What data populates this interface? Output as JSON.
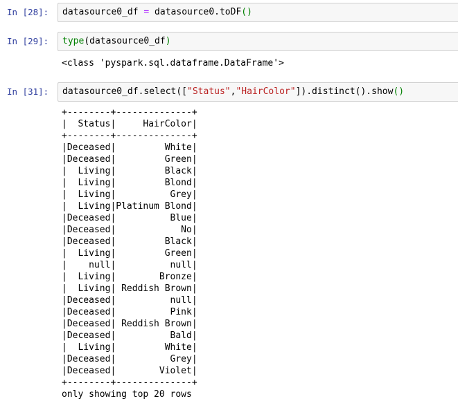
{
  "cells": [
    {
      "prompt": "In [28]:",
      "code": [
        {
          "text": "datasource0_df ",
          "cls": "tok-name"
        },
        {
          "text": "=",
          "cls": "tok-op"
        },
        {
          "text": " datasource0.toDF",
          "cls": "tok-name"
        },
        {
          "text": "()",
          "cls": "tok-kw"
        }
      ]
    },
    {
      "prompt": "In [29]:",
      "code": [
        {
          "text": "type",
          "cls": "tok-kw"
        },
        {
          "text": "(datasource0_df",
          "cls": "tok-name"
        },
        {
          "text": ")",
          "cls": "tok-kw"
        }
      ],
      "output": "<class 'pyspark.sql.dataframe.DataFrame'>"
    },
    {
      "prompt": "In [31]:",
      "code": [
        {
          "text": "datasource0_df.select([",
          "cls": "tok-name"
        },
        {
          "text": "\"Status\"",
          "cls": "tok-str"
        },
        {
          "text": ",",
          "cls": "tok-name"
        },
        {
          "text": "\"HairColor\"",
          "cls": "tok-str"
        },
        {
          "text": "]).distinct().show",
          "cls": "tok-name"
        },
        {
          "text": "()",
          "cls": "tok-kw"
        }
      ]
    }
  ],
  "table": {
    "border": "+--------+--------------+",
    "headers": [
      "Status",
      "HairColor"
    ],
    "rows": [
      [
        "Deceased",
        "White"
      ],
      [
        "Deceased",
        "Green"
      ],
      [
        "Living",
        "Black"
      ],
      [
        "Living",
        "Blond"
      ],
      [
        "Living",
        "Grey"
      ],
      [
        "Living",
        "Platinum Blond"
      ],
      [
        "Deceased",
        "Blue"
      ],
      [
        "Deceased",
        "No"
      ],
      [
        "Deceased",
        "Black"
      ],
      [
        "Living",
        "Green"
      ],
      [
        "null",
        "null"
      ],
      [
        "Living",
        "Bronze"
      ],
      [
        "Living",
        "Reddish Brown"
      ],
      [
        "Deceased",
        "null"
      ],
      [
        "Deceased",
        "Pink"
      ],
      [
        "Deceased",
        "Reddish Brown"
      ],
      [
        "Deceased",
        "Bald"
      ],
      [
        "Living",
        "White"
      ],
      [
        "Deceased",
        "Grey"
      ],
      [
        "Deceased",
        "Violet"
      ]
    ],
    "footer": "only showing top 20 rows"
  }
}
